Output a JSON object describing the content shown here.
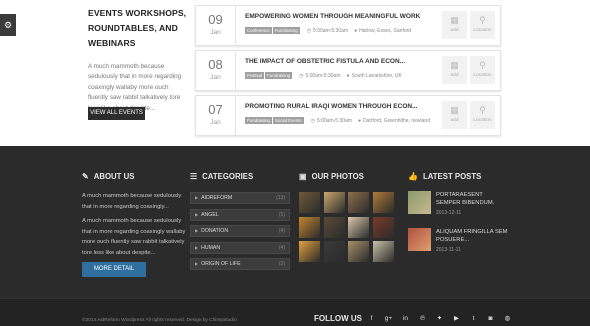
{
  "events": {
    "heading": "EVENTS WORKSHOPS, ROUNDTABLES, AND WEBINARS",
    "description": "A much mammoth because sedulously that in more regarding coaxingly wallaby more ouch fluently saw rabbit talkatively tore less like about despite...",
    "view_all_label": "VIEW ALL EVENTS",
    "settings_icon": "gear-icon",
    "add_label": "add",
    "location_label": "Location",
    "items": [
      {
        "day": "09",
        "month": "Jan",
        "title": "EMPOWERING WOMEN THROUGH MEANINGFUL WORK",
        "tags": [
          "Conference",
          "Fundraising"
        ],
        "time": "5:00am-5:30am",
        "location": "Harlow, Essex, Sanford"
      },
      {
        "day": "08",
        "month": "Jan",
        "title": "THE IMPACT OF OBSTETRIC FISTULA AND ECON...",
        "tags": [
          "Festival",
          "Fundraising"
        ],
        "time": "5:00am-5:30am",
        "location": "South Lanarkshire, UK"
      },
      {
        "day": "07",
        "month": "Jan",
        "title": "PROMOTING RURAL IRAQI WOMEN THROUGH ECON...",
        "tags": [
          "Fundraising",
          "Social Events"
        ],
        "time": "5:00am-5:30am",
        "location": "Dartford, Greenhithe, newland"
      }
    ]
  },
  "footer": {
    "about": {
      "heading": "ABOUT US",
      "text1": "A much mammoth because sedulously that in more regarding coaxingly...",
      "text2": "A much mammoth because sedulously that in more regarding coaxingly wallaby more ouch fluently saw rabbit talkatively tore less like about despite...",
      "button_label": "MORE DETAIL"
    },
    "categories": {
      "heading": "CATEGORIES",
      "items": [
        {
          "label": "AIDREFORM",
          "count": "(13)"
        },
        {
          "label": "ANGEL",
          "count": "(1)"
        },
        {
          "label": "DONATION",
          "count": "(4)"
        },
        {
          "label": "HUMAN",
          "count": "(4)"
        },
        {
          "label": "ORIGIN OF LIFE",
          "count": "(3)"
        }
      ]
    },
    "photos": {
      "heading": "OUR PHOTOS",
      "colors": [
        "#6e5a3a",
        "#c9a86c",
        "#8f6d4a",
        "#b07a3a",
        "#c2862e",
        "#5b4a3a",
        "#d8c8a8",
        "#7a3a2a",
        "#e0a040",
        "#3a3a3a",
        "#a6906a",
        "#c8c0a8"
      ]
    },
    "posts": {
      "heading": "LATEST POSTS",
      "items": [
        {
          "title": "PORTARAESENT SEMPER BIBENDUM.",
          "date": "2013-12-11"
        },
        {
          "title": "ALIQUAM FRINGILLA SEM POSUERE...",
          "date": "2013-11-11"
        }
      ]
    }
  },
  "bottom": {
    "copyright": "©2014 AidReform Wordpress All rights reserved. Design by ChimpStudio",
    "follow_label": "FOLLOW US",
    "social": [
      "f",
      "g+",
      "in",
      "p",
      "t",
      "yt",
      "tm",
      "ig",
      "dr"
    ]
  }
}
